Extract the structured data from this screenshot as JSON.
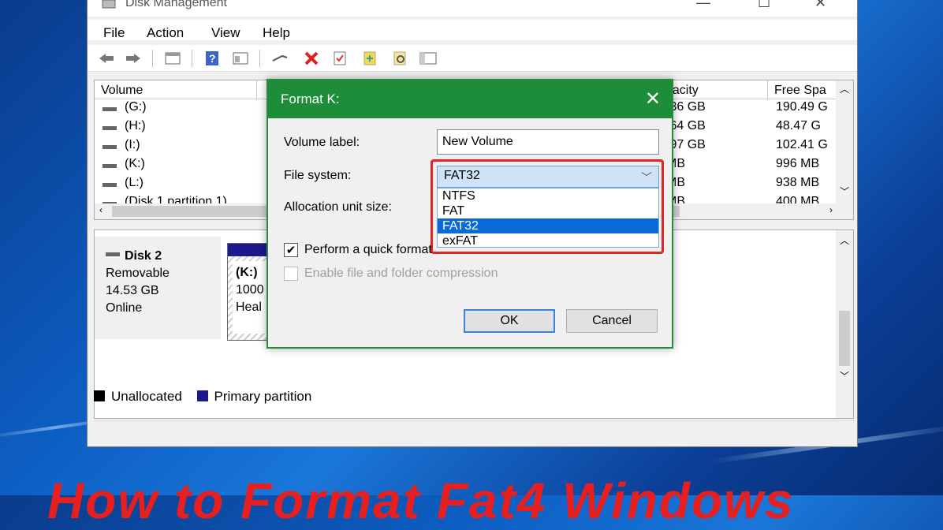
{
  "window": {
    "title": "Disk Management"
  },
  "menu": [
    "File",
    "Action",
    "View",
    "Help"
  ],
  "toolbar_icons": [
    "back-arrow-icon",
    "forward-arrow-icon",
    "properties-icon",
    "help-icon",
    "view-icon",
    "connect-icon",
    "delete-icon",
    "check-icon",
    "new-volume-icon",
    "search-icon",
    "console-icon"
  ],
  "volume_table": {
    "columns": [
      "Volume",
      "pacity",
      "Free Spa"
    ],
    "rows": [
      {
        "volume": "(G:)",
        "capacity": ".36 GB",
        "free": "190.49 G"
      },
      {
        "volume": "(H:)",
        "capacity": ".64 GB",
        "free": "48.47 G"
      },
      {
        "volume": "(I:)",
        "capacity": ".97 GB",
        "free": "102.41 G"
      },
      {
        "volume": "(K:)",
        "capacity": "MB",
        "free": "996 MB"
      },
      {
        "volume": "(L:)",
        "capacity": "MB",
        "free": "938 MB"
      },
      {
        "volume": "(Disk 1 partition 1)",
        "capacity": "MB",
        "free": "400 MB"
      }
    ]
  },
  "disk": {
    "name": "Disk 2",
    "type": "Removable",
    "size": "14.53 GB",
    "status": "Online",
    "partition": {
      "label": "(K:)",
      "size": "1000",
      "status": "Heal"
    }
  },
  "legend": [
    {
      "label": "Unallocated",
      "color": "#000000"
    },
    {
      "label": "Primary partition",
      "color": "#1a1a8c"
    }
  ],
  "dialog": {
    "title": "Format K:",
    "volume_label_text": "Volume label:",
    "volume_label_value": "New Volume",
    "file_system_text": "File system:",
    "file_system_value": "FAT32",
    "file_system_options": [
      "NTFS",
      "FAT",
      "FAT32",
      "exFAT"
    ],
    "selected_option": "FAT32",
    "allocation_text": "Allocation unit size:",
    "quick_format_text": "Perform a quick format",
    "quick_format_checked": true,
    "compression_text": "Enable file and folder compression",
    "compression_enabled": false,
    "ok_label": "OK",
    "cancel_label": "Cancel"
  },
  "overlay_caption": "How to Format Fat4 Windows",
  "colors": {
    "dialog_title": "#1e8d3a",
    "highlight": "#e02525",
    "selection": "#0a6bd8"
  }
}
